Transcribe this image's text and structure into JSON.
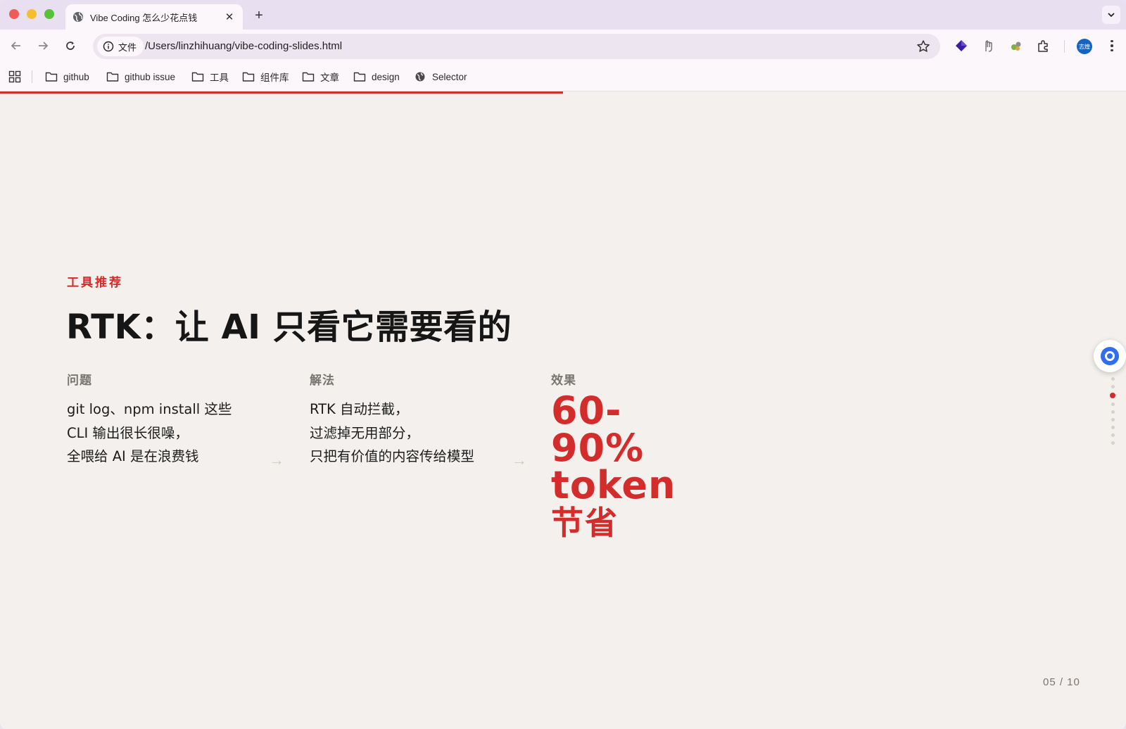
{
  "browser": {
    "tab_title": "Vibe Coding 怎么少花点钱",
    "chip_label": "文件",
    "url": "/Users/linzhihuang/vibe-coding-slides.html",
    "avatar_text": "志煌",
    "bookmarks": [
      {
        "label": "github",
        "icon": "folder-icon"
      },
      {
        "label": "github issue",
        "icon": "folder-icon"
      },
      {
        "label": "工具",
        "icon": "folder-icon"
      },
      {
        "label": "组件库",
        "icon": "folder-icon"
      },
      {
        "label": "文章",
        "icon": "folder-icon"
      },
      {
        "label": "design",
        "icon": "folder-icon"
      },
      {
        "label": "Selector",
        "icon": "globe-icon"
      }
    ],
    "progress_fraction": 0.5
  },
  "slide": {
    "eyebrow": "工具推荐",
    "headline": "RTK：让 AI 只看它需要看的",
    "columns": [
      {
        "label": "问题",
        "lines": [
          "git log、npm install 这些",
          "CLI 输出很长很噪，",
          "全喂给 AI 是在浪费钱"
        ]
      },
      {
        "label": "解法",
        "lines": [
          "RTK 自动拦截，",
          "过滤掉无用部分，",
          "只把有价值的内容传给模型"
        ]
      },
      {
        "label": "效果",
        "result_lines": [
          "60-",
          "90%",
          "token",
          "节省"
        ]
      }
    ],
    "arrow": "→",
    "pager": "05 / 10",
    "nav_dots": {
      "count": 9,
      "active_index": 2
    }
  },
  "colors": {
    "accent": "#d42b2b",
    "background": "#f3f0ed",
    "tabstrip": "#e8dff1"
  }
}
